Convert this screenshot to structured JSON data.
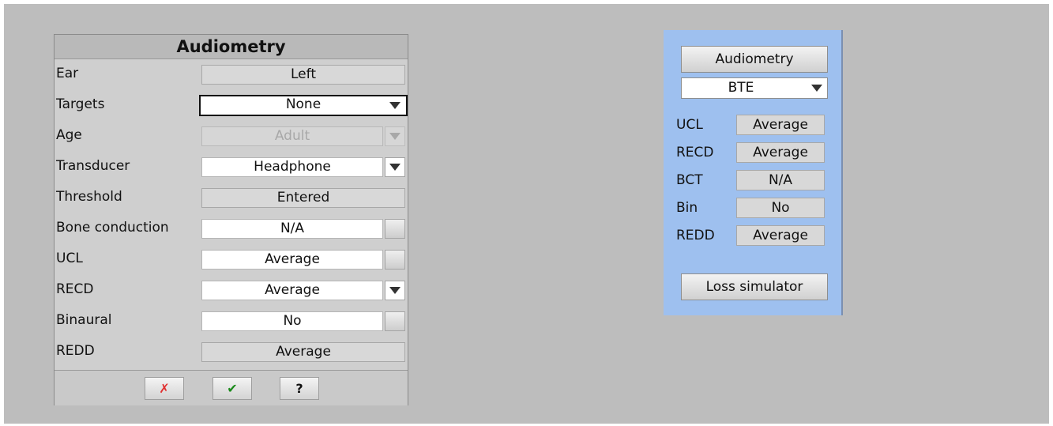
{
  "dialog": {
    "title": "Audiometry",
    "rows": [
      {
        "label": "Ear",
        "value": "Left"
      },
      {
        "label": "Targets",
        "value": "None"
      },
      {
        "label": "Age",
        "value": "Adult"
      },
      {
        "label": "Transducer",
        "value": "Headphone"
      },
      {
        "label": "Threshold",
        "value": "Entered"
      },
      {
        "label": "Bone conduction",
        "value": "N/A"
      },
      {
        "label": "UCL",
        "value": "Average"
      },
      {
        "label": "RECD",
        "value": "Average"
      },
      {
        "label": "Binaural",
        "value": "No"
      },
      {
        "label": "REDD",
        "value": "Average"
      }
    ],
    "footer": {
      "cancel_icon": "x-mark",
      "cancel_glyph": "✗",
      "ok_icon": "checkmark",
      "ok_glyph": "✔",
      "help_label": "?"
    }
  },
  "panel": {
    "audiometry_button": "Audiometry",
    "style_select": "BTE",
    "rows": [
      {
        "label": "UCL",
        "value": "Average"
      },
      {
        "label": "RECD",
        "value": "Average"
      },
      {
        "label": "BCT",
        "value": "N/A"
      },
      {
        "label": "Bin",
        "value": "No"
      },
      {
        "label": "REDD",
        "value": "Average"
      }
    ],
    "loss_simulator_button": "Loss simulator"
  },
  "colors": {
    "background": "#bdbdbd",
    "panel": "#9ec0ef",
    "cancel": "#e03030",
    "ok": "#1a8a1a"
  }
}
